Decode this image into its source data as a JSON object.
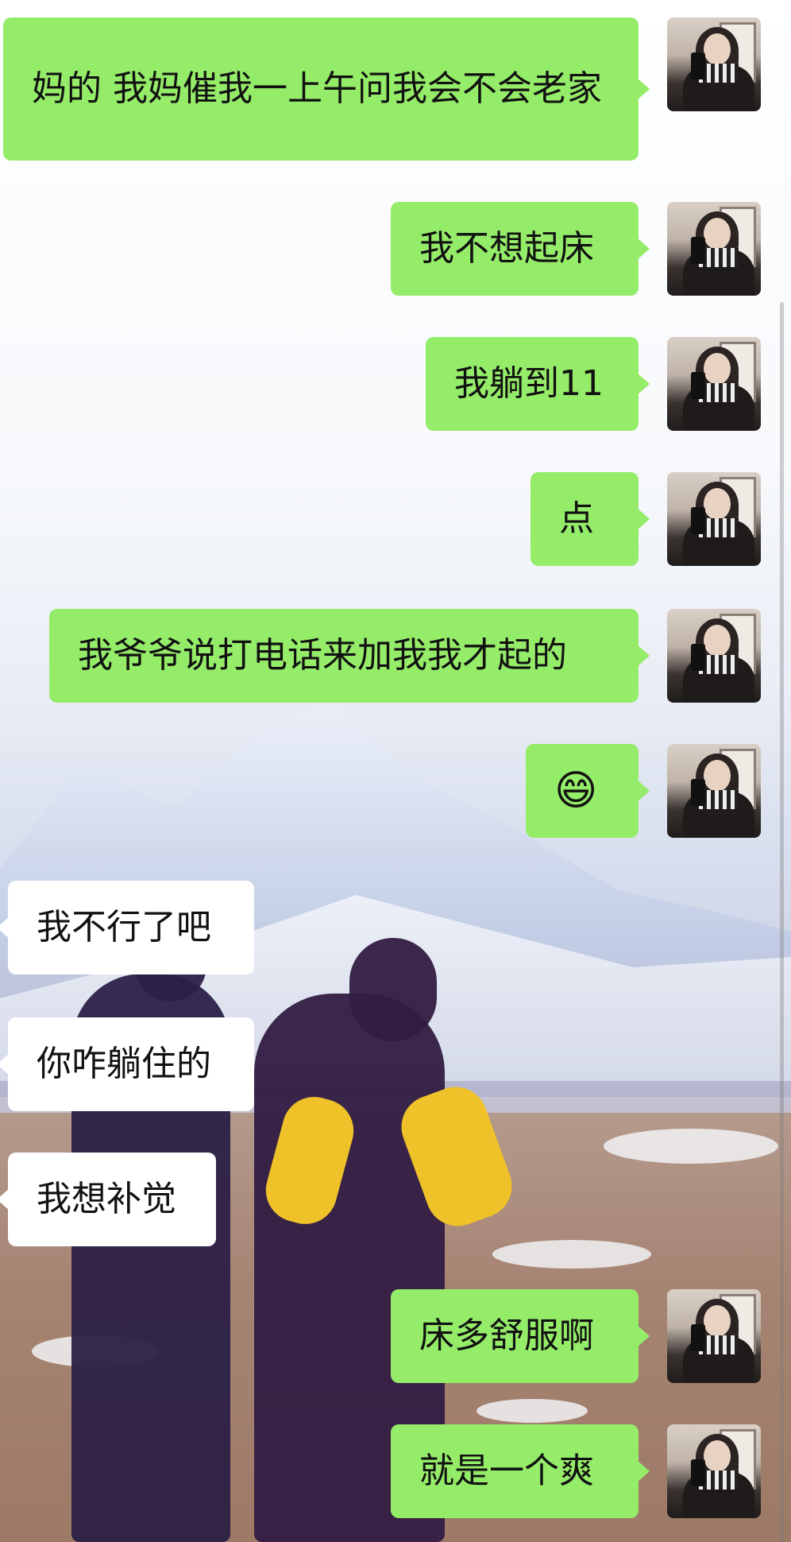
{
  "messages": [
    {
      "side": "out",
      "text": "妈的 我妈催我一上午问我会不会老家"
    },
    {
      "side": "out",
      "text": "我不想起床"
    },
    {
      "side": "out",
      "text": "我躺到11"
    },
    {
      "side": "out",
      "text": "点"
    },
    {
      "side": "out",
      "text": "我爷爷说打电话来加我我才起的"
    },
    {
      "side": "out",
      "text": "😄"
    },
    {
      "side": "in",
      "text": "我不行了吧"
    },
    {
      "side": "in",
      "text": "你咋躺住的"
    },
    {
      "side": "in",
      "text": "我想补觉"
    },
    {
      "side": "out",
      "text": "床多舒服啊"
    },
    {
      "side": "out",
      "text": "就是一个爽"
    }
  ],
  "colors": {
    "outgoing_bubble": "#95ec69",
    "incoming_bubble": "#ffffff"
  },
  "icons": {
    "emoji": "grinning-face-emoji",
    "avatar": "user-avatar-photo"
  }
}
